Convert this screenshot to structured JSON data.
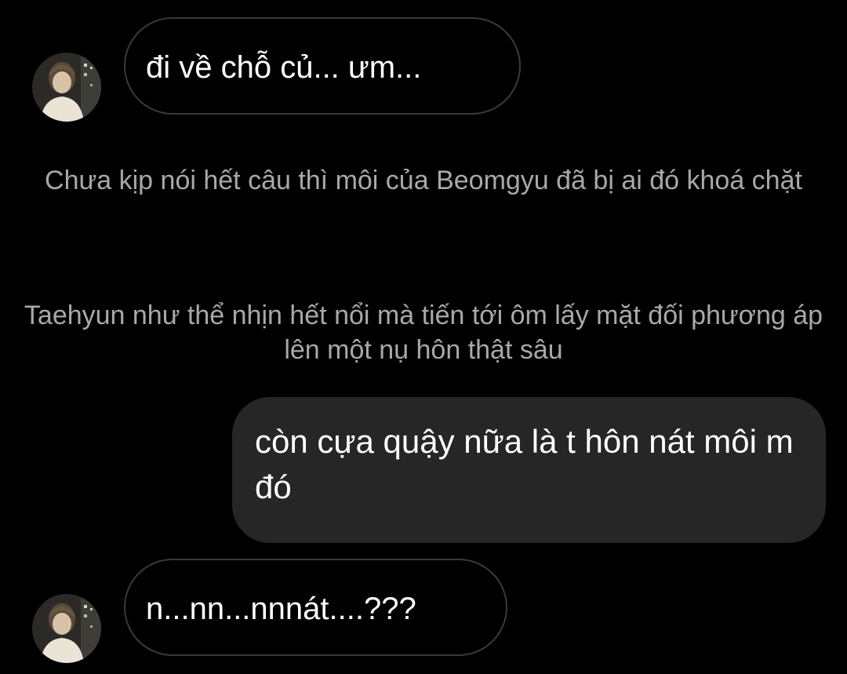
{
  "messages": [
    {
      "type": "received",
      "sender_avatar": "avatar-photo",
      "text": "đi về chỗ củ... ưm..."
    },
    {
      "type": "narration",
      "text": "Chưa kịp nói hết câu thì môi của Beomgyu đã bị ai đó khoá chặt"
    },
    {
      "type": "narration",
      "text": "Taehyun như thể nhịn hết nổi mà tiến tới ôm lấy mặt đối phương áp lên một nụ hôn thật sâu"
    },
    {
      "type": "sent",
      "text": "còn cựa quậy nữa là t hôn nát môi m đó"
    },
    {
      "type": "received",
      "sender_avatar": "avatar-photo",
      "text": "n...nn...nnnát....???"
    }
  ],
  "colors": {
    "background": "#000000",
    "received_bubble_border": "#3a3a3a",
    "sent_bubble_fill": "#262626",
    "message_text": "#ffffff",
    "narration_text": "#a8a8a8"
  }
}
